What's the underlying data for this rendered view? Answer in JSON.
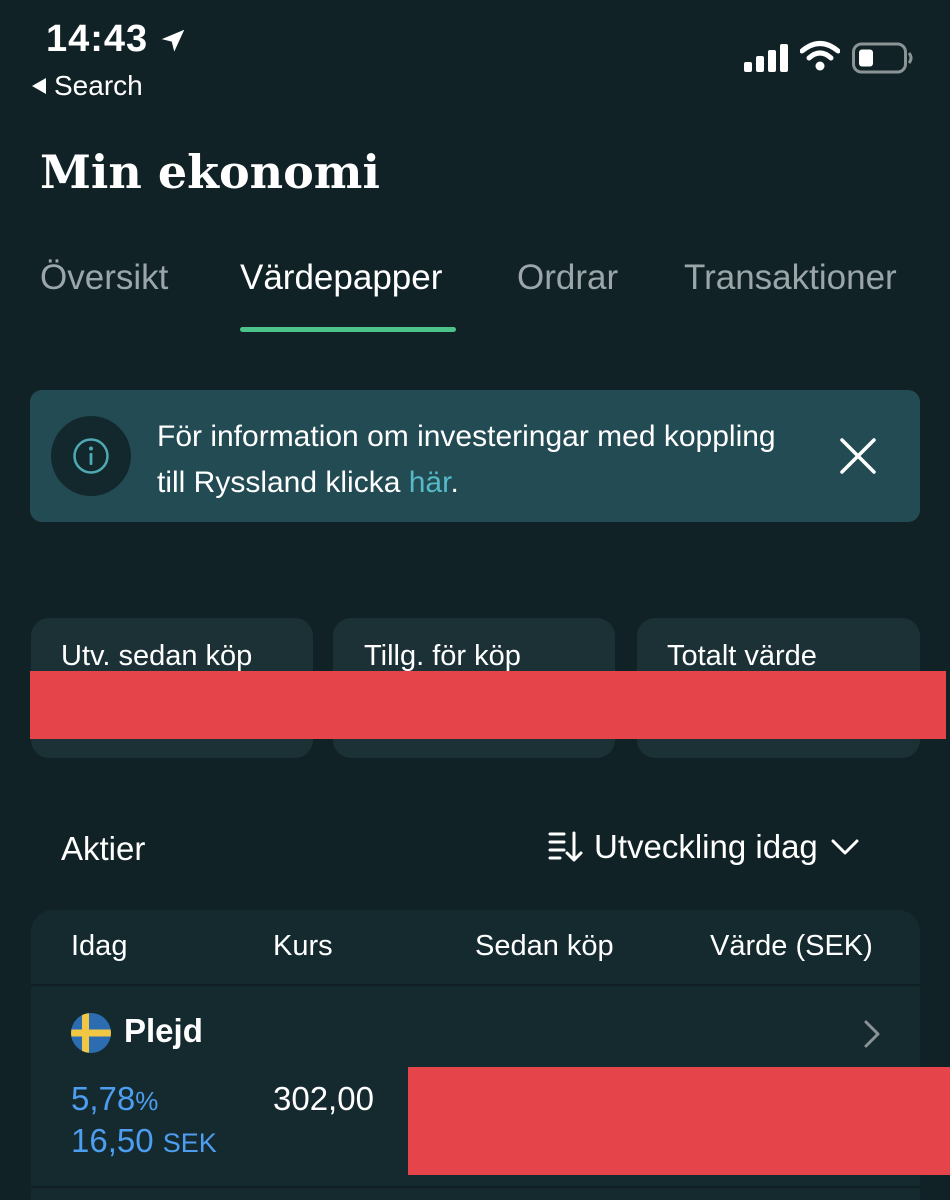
{
  "status_bar": {
    "time": "14:43",
    "back_label": "Search"
  },
  "page": {
    "title": "Min ekonomi"
  },
  "tabs": [
    {
      "label": "Översikt",
      "active": false
    },
    {
      "label": "Värdepapper",
      "active": true
    },
    {
      "label": "Ordrar",
      "active": false
    },
    {
      "label": "Transaktioner",
      "active": false
    }
  ],
  "banner": {
    "text": "För information om investeringar med koppling till Ryssland klicka ",
    "link_text": "här",
    "suffix": "."
  },
  "summary_cards": [
    {
      "label": "Utv. sedan köp"
    },
    {
      "label": "Tillg. för köp"
    },
    {
      "label": "Totalt värde"
    }
  ],
  "section": {
    "title": "Aktier",
    "sort_label": "Utveckling idag"
  },
  "table": {
    "headers": [
      "Idag",
      "Kurs",
      "Sedan köp",
      "Värde (SEK)"
    ],
    "rows": [
      {
        "name": "Plejd",
        "country_flag": "sweden-flag",
        "today_pct": "5,78",
        "pct_unit": "%",
        "today_amount": "16,50",
        "amount_unit": "SEK",
        "price": "302,00"
      }
    ]
  },
  "colors": {
    "background": "#112226",
    "accent_green": "#4cc38a",
    "positive_blue": "#4d9df0",
    "link": "#56b9c6",
    "redaction": "#e5444a"
  }
}
